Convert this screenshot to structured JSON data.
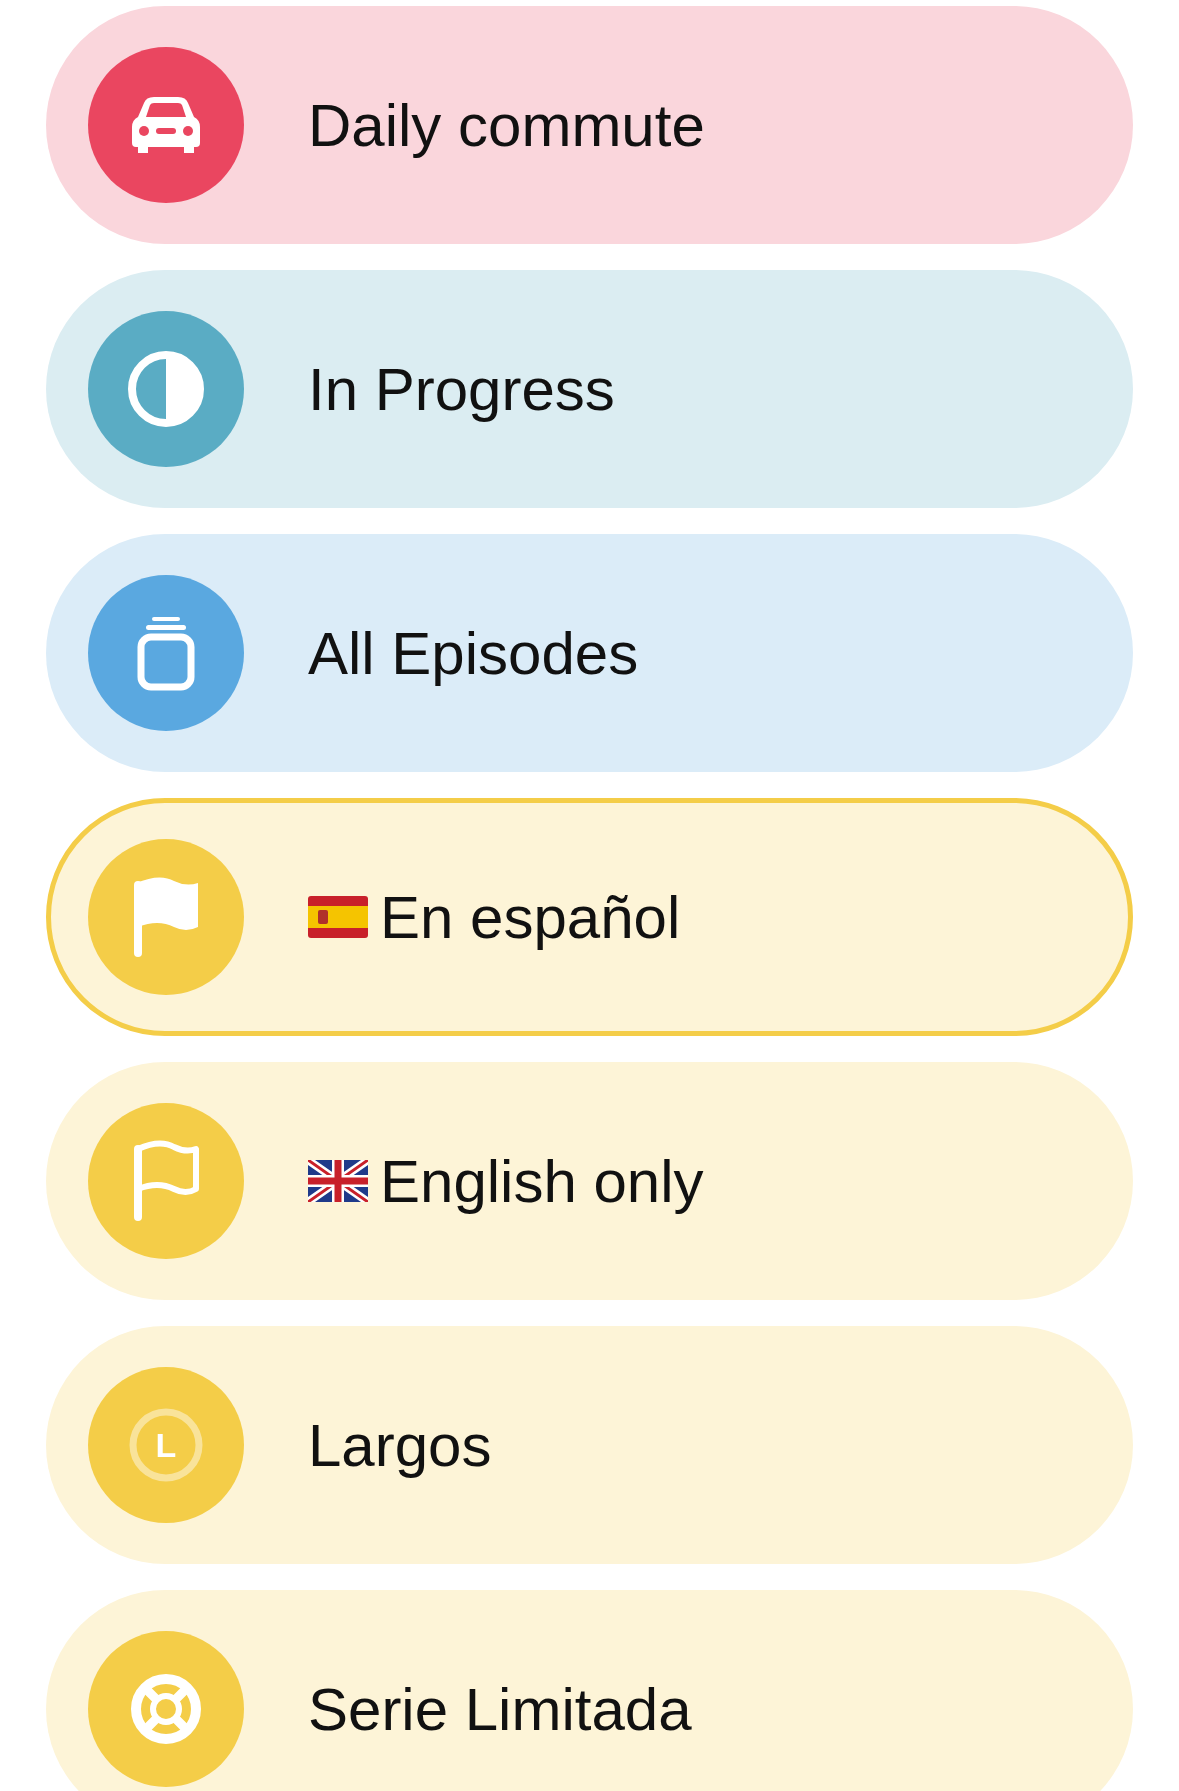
{
  "filters": [
    {
      "label": "Daily commute",
      "kind": "car",
      "color": "#ea4660",
      "selected": false
    },
    {
      "label": "In Progress",
      "kind": "contrast",
      "color": "#5aacc4",
      "selected": false
    },
    {
      "label": "All Episodes",
      "kind": "stack",
      "color": "#5aa8e0",
      "selected": false
    },
    {
      "label": "En español",
      "kind": "spanish",
      "color": "#f4cd48",
      "selected": true
    },
    {
      "label": "English only",
      "kind": "english",
      "color": "#f4cd48",
      "selected": false
    },
    {
      "label": "Largos",
      "kind": "letter",
      "badge": "L",
      "color": "#f4cd48",
      "selected": false
    },
    {
      "label": "Serie Limitada",
      "kind": "lifebuoy",
      "color": "#f4cd48",
      "selected": false
    }
  ]
}
